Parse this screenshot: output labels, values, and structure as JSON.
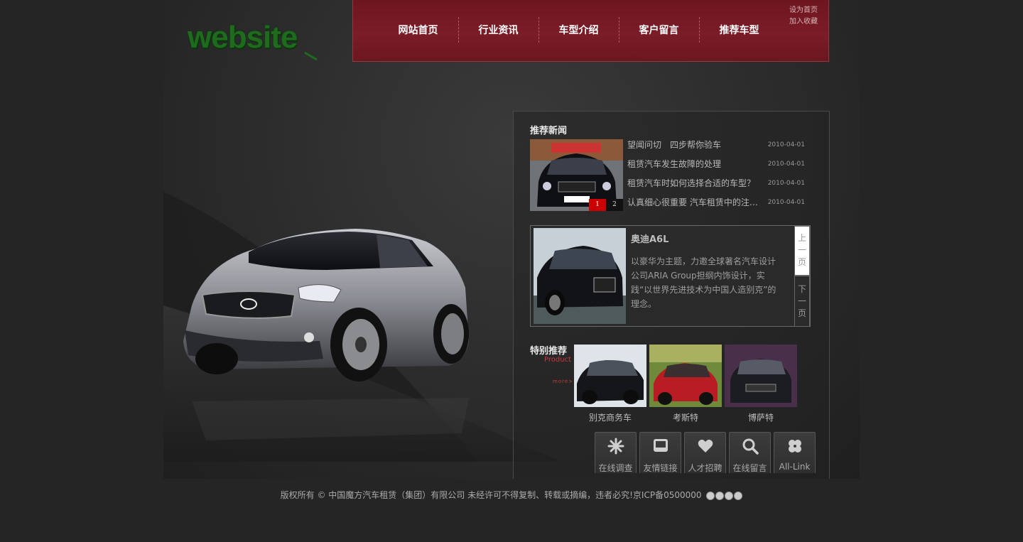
{
  "logo": {
    "text": "website"
  },
  "nav": {
    "items": [
      "网站首页",
      "行业资讯",
      "车型介绍",
      "客户留言",
      "推荐车型"
    ],
    "set_home": "设为首页",
    "favorite": "加入收藏"
  },
  "news": {
    "title": "推荐新闻",
    "pager": [
      "1",
      "2"
    ],
    "items": [
      {
        "title": "望闻问切　四步帮你验车",
        "date": "2010-04-01"
      },
      {
        "title": "租赁汽车发生故障的处理",
        "date": "2010-04-01"
      },
      {
        "title": "租赁汽车时如何选择合适的车型？",
        "date": "2010-04-01"
      },
      {
        "title": "认真细心很重要 汽车租赁中的注意事项",
        "date": "2010-04-01"
      }
    ]
  },
  "feature": {
    "name": "奥迪A6L",
    "description": "以豪华为主题，力邀全球著名汽车设计公司ARIA Group担纲内饰设计，实践“以世界先进技术为中国人造别克”的理念。",
    "prev": "上一页",
    "next": "下一页"
  },
  "special": {
    "title": "特别推荐",
    "subtitle": "Product",
    "more": "more>",
    "products": [
      "别克商务车",
      "考斯特",
      "博萨特"
    ]
  },
  "tools": [
    {
      "label": "在线调查",
      "icon": "asterisk-icon"
    },
    {
      "label": "友情链接",
      "icon": "monitor-icon"
    },
    {
      "label": "人才招聘",
      "icon": "heart-icon"
    },
    {
      "label": "在线留言",
      "icon": "search-icon"
    },
    {
      "label": "All-Link",
      "icon": "clover-icon"
    }
  ],
  "footer": {
    "text": "版权所有 © 中国魔方汽车租赁（集团）有限公司 未经许可不得复制、转载或摘编，违者必究!京ICP备0500000"
  },
  "colors": {
    "nav_bg": "#7b1c27",
    "accent_red": "#c9383f",
    "page_bg": "#252525",
    "logo_green": "#1e6b1e"
  }
}
